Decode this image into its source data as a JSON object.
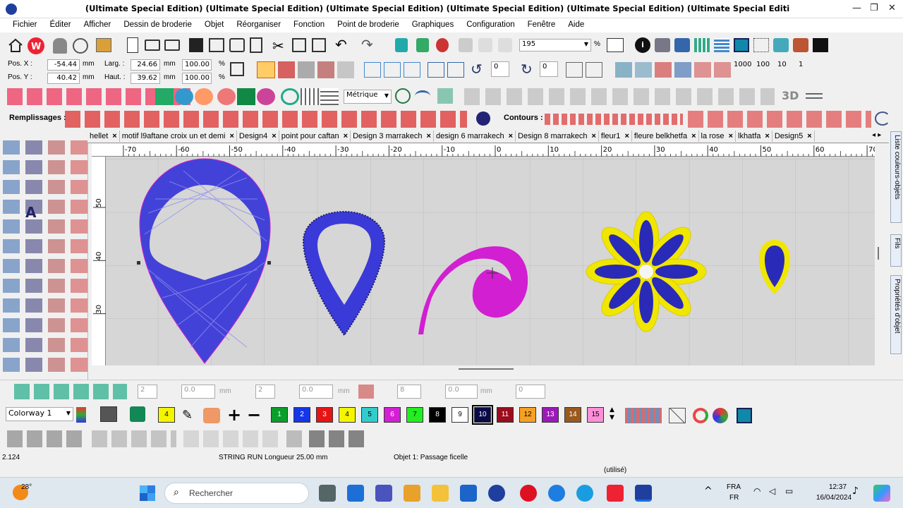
{
  "window": {
    "title": "(Ultimate Special Edition) (Ultimate Special Edition) (Ultimate Special Edition) (Ultimate Special Edition) (Ultimate Special Edition) (Ultimate Special Editi"
  },
  "menu": [
    "Fichier",
    "Éditer",
    "Afficher",
    "Dessin de broderie",
    "Objet",
    "Réorganiser",
    "Fonction",
    "Point de broderie",
    "Graphiques",
    "Configuration",
    "Fenêtre",
    "Aide"
  ],
  "zoom": {
    "value": "195",
    "unit": "%"
  },
  "position": {
    "posx_label": "Pos. X :",
    "posx": "-54.44",
    "posx_unit": "mm",
    "posy_label": "Pos. Y :",
    "posy": "40.42",
    "posy_unit": "mm"
  },
  "size": {
    "larg_label": "Larg. :",
    "larg": "24.66",
    "larg_unit": "mm",
    "larg_pct": "100.00",
    "haut_label": "Haut. :",
    "haut": "39.62",
    "haut_unit": "mm",
    "haut_pct": "100.00",
    "pct": "%"
  },
  "rotation": {
    "val1": "0",
    "val2": "0"
  },
  "units_select": "Métrique",
  "fills_label": "Remplissages :",
  "contours_label": "Contours :",
  "tabs": [
    {
      "label": "hellet"
    },
    {
      "label": "motif l9aftane croix un et demi"
    },
    {
      "label": "Design4"
    },
    {
      "label": "point pour caftan"
    },
    {
      "label": "Design 3 marrakech"
    },
    {
      "label": "design 6 marrakech"
    },
    {
      "label": "Design 8 marrakech"
    },
    {
      "label": "fleur1"
    },
    {
      "label": "fleure belkhetfa"
    },
    {
      "label": "la rose"
    },
    {
      "label": "lkhatfa"
    },
    {
      "label": "Design5"
    }
  ],
  "ruler_x": [
    "-70",
    "-60",
    "-50",
    "-40",
    "-30",
    "-20",
    "-10",
    "0",
    "10",
    "20",
    "30",
    "40",
    "50",
    "60",
    "70"
  ],
  "ruler_y": [
    "50",
    "40",
    "30"
  ],
  "side_panels": [
    "Liste couleurs-objets",
    "Fils",
    "Propriétés d'objet"
  ],
  "bottom_toolbar": {
    "v1": "2",
    "v2": "0.0",
    "u1": "mm",
    "v3": "2",
    "v4": "0.0",
    "u2": "mm",
    "v5": "8",
    "v6": "0.0",
    "u3": "mm",
    "v7": "0"
  },
  "colorway": "Colorway 1",
  "current_color": "4",
  "palette": [
    {
      "n": "1",
      "c": "#0a9e2a",
      "fg": "#fff"
    },
    {
      "n": "2",
      "c": "#1537e8",
      "fg": "#fff"
    },
    {
      "n": "3",
      "c": "#e61414",
      "fg": "#fff"
    },
    {
      "n": "4",
      "c": "#f5f500",
      "fg": "#000"
    },
    {
      "n": "5",
      "c": "#33cccc",
      "fg": "#000"
    },
    {
      "n": "6",
      "c": "#d41fd4",
      "fg": "#fff"
    },
    {
      "n": "7",
      "c": "#22ee22",
      "fg": "#000"
    },
    {
      "n": "8",
      "c": "#000000",
      "fg": "#fff"
    },
    {
      "n": "9",
      "c": "#ffffff",
      "fg": "#000"
    },
    {
      "n": "10",
      "c": "#0a0a4a",
      "fg": "#fff"
    },
    {
      "n": "11",
      "c": "#9b0c1c",
      "fg": "#fff"
    },
    {
      "n": "12",
      "c": "#f7a022",
      "fg": "#000"
    },
    {
      "n": "13",
      "c": "#9c1ab8",
      "fg": "#fff"
    },
    {
      "n": "14",
      "c": "#9a5a1e",
      "fg": "#fff"
    },
    {
      "n": "15",
      "c": "#ff8fd8",
      "fg": "#000"
    }
  ],
  "status": {
    "left": "2.124",
    "middle": "STRING RUN Longueur  25.00 mm",
    "object": "Objet 1: Passage ficelle",
    "used": "(utilisé)"
  },
  "taskbar": {
    "weather_temp": "28°",
    "search_placeholder": "Rechercher",
    "lang1": "FRA",
    "lang2": "FR",
    "time": "12:37",
    "date": "16/04/2024"
  },
  "colors": {
    "blue_stitch": "#3a3ad8",
    "magenta_stitch": "#d21fd2",
    "yellow_stitch": "#f0e600",
    "accent": "#0a64c8"
  }
}
